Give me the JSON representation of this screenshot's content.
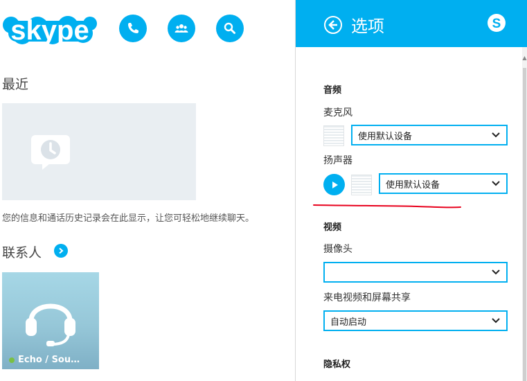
{
  "left": {
    "logo_text": "skype",
    "recent_title": "最近",
    "recent_info": "您的信息和通话历史记录会在此显示，让您可轻松地继续聊天。",
    "contacts_title": "联系人",
    "contact": {
      "name": "Echo / Sou…",
      "status": "online"
    }
  },
  "options": {
    "title": "选项",
    "audio_heading": "音频",
    "microphone_label": "麦克风",
    "microphone_value": "使用默认设备",
    "speaker_label": "扬声器",
    "speaker_value": "使用默认设备",
    "video_heading": "视频",
    "camera_label": "摄像头",
    "camera_value": "",
    "incoming_label": "来电视频和屏幕共享",
    "incoming_value": "自动启动",
    "privacy_heading": "隐私权"
  },
  "colors": {
    "accent": "#00aff0",
    "annotation": "#e8001c",
    "online": "#7ac043"
  },
  "icons": {
    "call": "phone-icon",
    "contacts": "people-icon",
    "search": "search-icon",
    "back": "back-arrow-icon",
    "skype": "skype-icon",
    "recent": "chat-clock-icon",
    "play": "play-icon",
    "chevron": "chevron-down-icon"
  }
}
